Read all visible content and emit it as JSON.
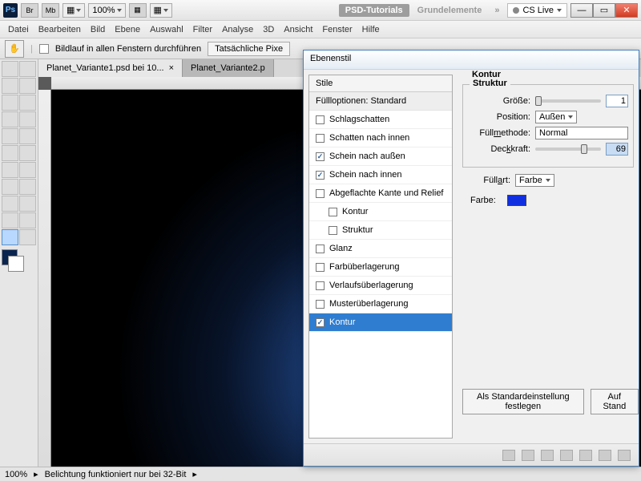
{
  "titlebar": {
    "br": "Br",
    "mb": "Mb",
    "zoom": "100%",
    "workspace1": "PSD-Tutorials",
    "workspace2": "Grundelemente",
    "more": "»",
    "cslive": "CS Live"
  },
  "menu": [
    "Datei",
    "Bearbeiten",
    "Bild",
    "Ebene",
    "Auswahl",
    "Filter",
    "Analyse",
    "3D",
    "Ansicht",
    "Fenster",
    "Hilfe"
  ],
  "optbar": {
    "scroll_all": "Bildlauf in allen Fenstern durchführen",
    "btn1": "Tatsächliche Pixe"
  },
  "tabs": [
    {
      "label": "Planet_Variante1.psd bei 10...",
      "active": true
    },
    {
      "label": "Planet_Variante2.p",
      "active": false
    }
  ],
  "status": {
    "zoom": "100%",
    "msg": "Belichtung funktioniert nur bei 32-Bit"
  },
  "dialog": {
    "title": "Ebenenstil",
    "list_header": "Stile",
    "fill_opts": "Füllloptionen: Standard",
    "items": [
      {
        "label": "Schlagschatten",
        "checked": false,
        "sub": false
      },
      {
        "label": "Schatten nach innen",
        "checked": false,
        "sub": false
      },
      {
        "label": "Schein nach außen",
        "checked": true,
        "sub": false
      },
      {
        "label": "Schein nach innen",
        "checked": true,
        "sub": false
      },
      {
        "label": "Abgeflachte Kante und Relief",
        "checked": false,
        "sub": false
      },
      {
        "label": "Kontur",
        "checked": false,
        "sub": true
      },
      {
        "label": "Struktur",
        "checked": false,
        "sub": true
      },
      {
        "label": "Glanz",
        "checked": false,
        "sub": false
      },
      {
        "label": "Farbüberlagerung",
        "checked": false,
        "sub": false
      },
      {
        "label": "Verlaufsüberlagerung",
        "checked": false,
        "sub": false
      },
      {
        "label": "Musterüberlagerung",
        "checked": false,
        "sub": false
      },
      {
        "label": "Kontur",
        "checked": true,
        "sub": false,
        "selected": true
      }
    ],
    "section": "Kontur",
    "struct": "Struktur",
    "size_lbl": "Größe:",
    "size_val": "1",
    "pos_lbl": "Position:",
    "pos_val": "Außen",
    "fill_lbl": "Füllmethode:",
    "fill_val": "Normal",
    "opac_lbl": "Deckkraft:",
    "opac_val": "69",
    "fillart_lbl": "Füllart:",
    "fillart_val": "Farbe",
    "color_lbl": "Farbe:",
    "btn_default": "Als Standardeinstellung festlegen",
    "btn_reset": "Auf Stand"
  }
}
